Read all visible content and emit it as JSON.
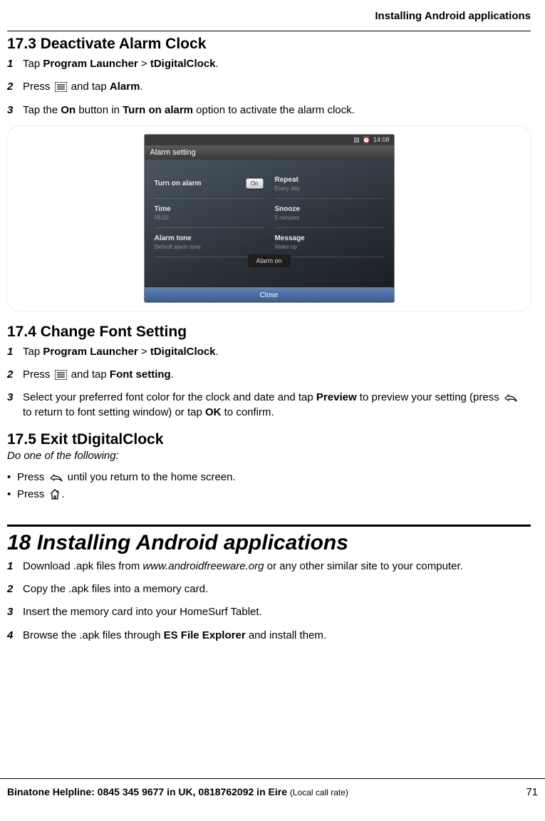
{
  "header": {
    "running_title": "Installing Android applications"
  },
  "s17_3": {
    "heading": "17.3  Deactivate Alarm Clock",
    "step1": {
      "n": "1",
      "a": "Tap ",
      "b": "Program Launcher",
      "c": " > ",
      "d": "tDigitalClock",
      "e": "."
    },
    "step2": {
      "n": "2",
      "a": "Press ",
      "b": " and tap ",
      "c": "Alarm",
      "d": "."
    },
    "step3": {
      "n": "3",
      "a": "Tap the ",
      "b": "On",
      "c": " button in ",
      "d": "Turn on alarm",
      "e": " option to activate the alarm clock."
    }
  },
  "device": {
    "status_tab": "",
    "status_time": "14:08",
    "titlebar": "Alarm setting",
    "rows": {
      "turn_on": "Turn on alarm",
      "on_btn": "On",
      "repeat": "Repeat",
      "repeat_sub": "Every day",
      "time": "Time",
      "time_sub": "08:00",
      "snooze": "Snooze",
      "snooze_sub": "5 minutes",
      "tone": "Alarm tone",
      "tone_sub": "Default alarm tone",
      "message": "Message",
      "message_sub": "Wake up"
    },
    "toast": "Alarm on",
    "close": "Close"
  },
  "s17_4": {
    "heading": "17.4  Change Font Setting",
    "step1": {
      "n": "1",
      "a": "Tap ",
      "b": "Program Launcher",
      "c": " > ",
      "d": "tDigitalClock",
      "e": "."
    },
    "step2": {
      "n": "2",
      "a": "Press ",
      "b": " and tap ",
      "c": "Font setting",
      "d": "."
    },
    "step3": {
      "n": "3",
      "a": "Select your preferred font color for the clock and date and tap ",
      "b": "Preview",
      "c": " to preview your setting (press ",
      "d": " to return to font setting window) or tap ",
      "e": "OK",
      "f": " to confirm."
    }
  },
  "s17_5": {
    "heading": "17.5  Exit tDigitalClock",
    "intro": "Do one of the following:",
    "b1a": "Press ",
    "b1b": " until you return to the home screen.",
    "b2a": "Press ",
    "b2b": "."
  },
  "s18": {
    "heading": "18 Installing Android applications",
    "step1": {
      "n": "1",
      "a": "Download .apk files from ",
      "b": "www.androidfreeware.org",
      "c": " or any other similar site to your computer."
    },
    "step2": {
      "n": "2",
      "a": "Copy the .apk files into a memory card."
    },
    "step3": {
      "n": "3",
      "a": "Insert the memory card into your HomeSurf Tablet."
    },
    "step4": {
      "n": "4",
      "a": "Browse the .apk files through ",
      "b": "ES File Explorer",
      "c": " and install them."
    }
  },
  "footer": {
    "helpline": "Binatone Helpline: 0845 345 9677 in UK, 0818762092 in Eire ",
    "rate": "(Local call rate)",
    "pageno": "71"
  }
}
